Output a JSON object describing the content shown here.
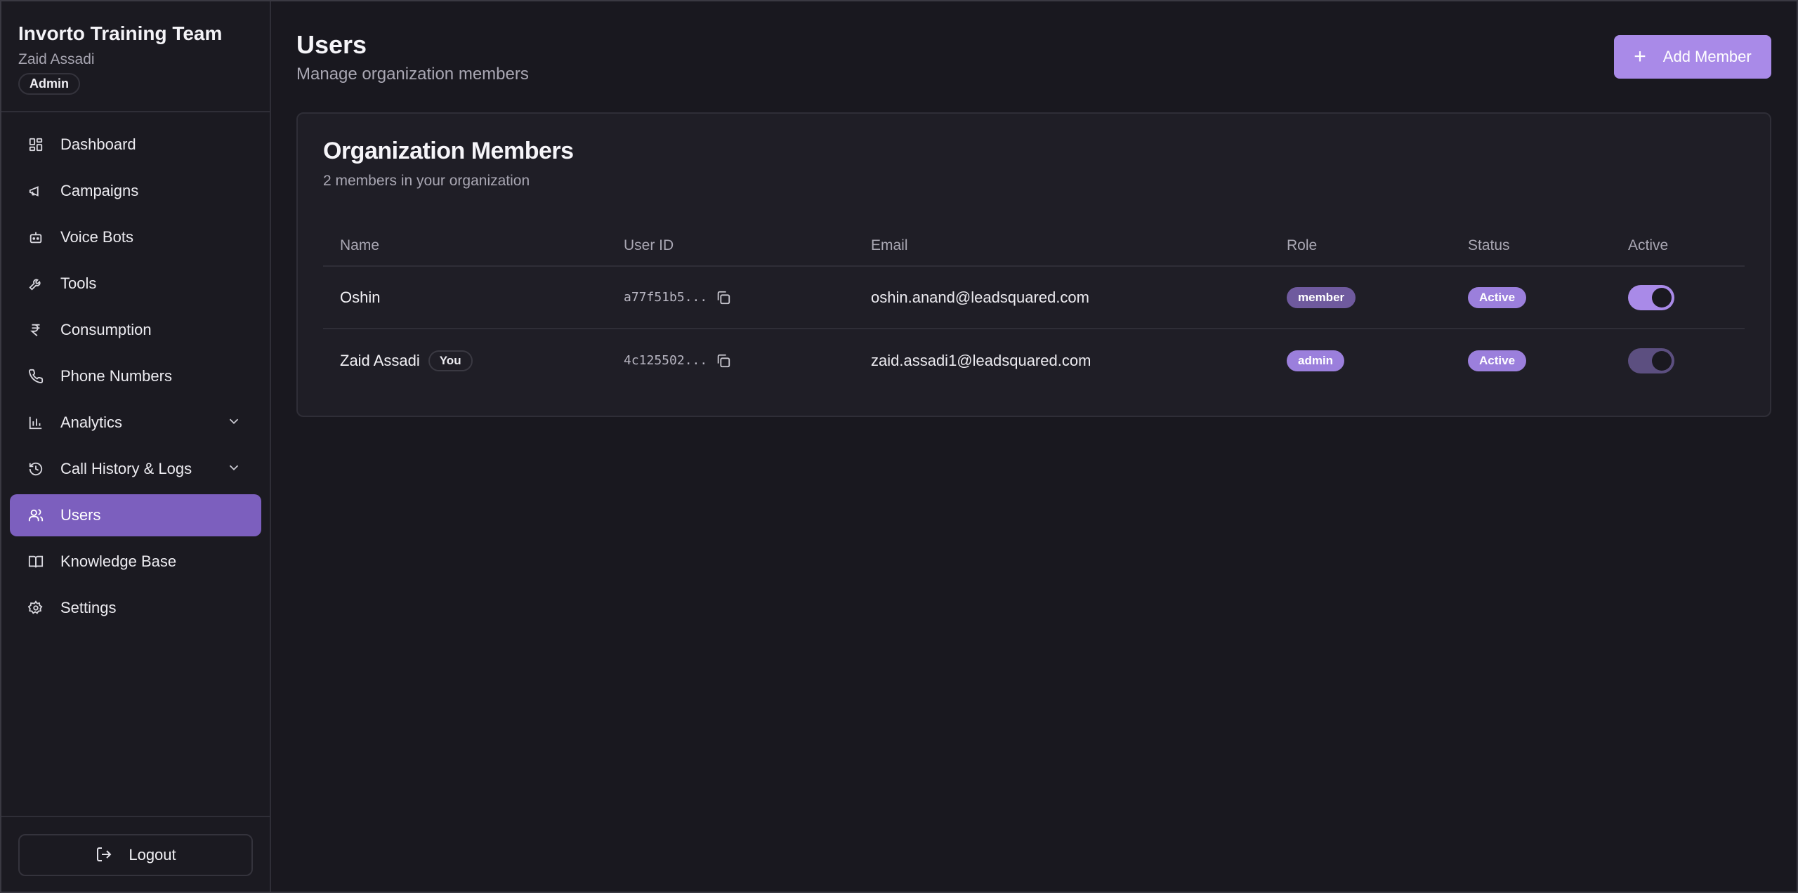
{
  "org": {
    "name": "Invorto Training Team",
    "user": "Zaid Assadi",
    "role": "Admin"
  },
  "nav": [
    {
      "label": "Dashboard",
      "icon": "dashboard-icon"
    },
    {
      "label": "Campaigns",
      "icon": "megaphone-icon"
    },
    {
      "label": "Voice Bots",
      "icon": "bot-icon"
    },
    {
      "label": "Tools",
      "icon": "wrench-icon"
    },
    {
      "label": "Consumption",
      "icon": "rupee-icon"
    },
    {
      "label": "Phone Numbers",
      "icon": "phone-icon"
    },
    {
      "label": "Analytics",
      "icon": "bar-chart-icon",
      "expandable": true
    },
    {
      "label": "Call History & Logs",
      "icon": "history-icon",
      "expandable": true
    },
    {
      "label": "Users",
      "icon": "users-icon",
      "active": true
    },
    {
      "label": "Knowledge Base",
      "icon": "book-icon"
    },
    {
      "label": "Settings",
      "icon": "gear-icon"
    }
  ],
  "logout": {
    "label": "Logout"
  },
  "header": {
    "title": "Users",
    "subtitle": "Manage organization members",
    "add_button": "Add Member"
  },
  "members": {
    "title": "Organization Members",
    "subtitle": "2 members in your organization",
    "columns": [
      "Name",
      "User ID",
      "Email",
      "Role",
      "Status",
      "Active"
    ],
    "rows": [
      {
        "name": "Oshin",
        "you": "",
        "user_id": "a77f51b5...",
        "email": "oshin.anand@leadsquared.com",
        "role": "member",
        "status": "Active",
        "active": true
      },
      {
        "name": "Zaid Assadi",
        "you": "You",
        "user_id": "4c125502...",
        "email": "zaid.assadi1@leadsquared.com",
        "role": "admin",
        "status": "Active",
        "active": true
      }
    ]
  },
  "colors": {
    "accent": "#a98ae8",
    "active_nav": "#7c5fbe",
    "background": "#19181f"
  }
}
